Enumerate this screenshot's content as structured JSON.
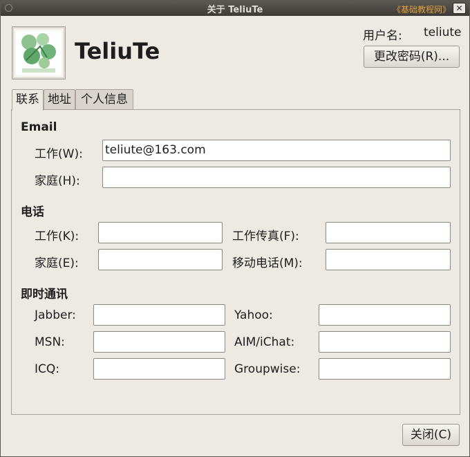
{
  "window": {
    "title": "关于 TeliuTe",
    "watermark": "《基础教程网》",
    "close_glyph": "✕"
  },
  "header": {
    "display_name": "TeliuTe",
    "username_label": "用户名:",
    "username_value": "teliute",
    "change_password_label": "更改密码(R)..."
  },
  "tabs": [
    {
      "label": "联系",
      "active": true
    },
    {
      "label": "地址",
      "active": false
    },
    {
      "label": "个人信息",
      "active": false
    }
  ],
  "email": {
    "heading": "Email",
    "work_label": "工作(W):",
    "work_value": "teliute@163.com",
    "home_label": "家庭(H):",
    "home_value": ""
  },
  "phone": {
    "heading": "电话",
    "work_label": "工作(K):",
    "work_value": "",
    "work_fax_label": "工作传真(F):",
    "work_fax_value": "",
    "home_label": "家庭(E):",
    "home_value": "",
    "mobile_label": "移动电话(M):",
    "mobile_value": ""
  },
  "im": {
    "heading": "即时通讯",
    "jabber_label": "Jabber:",
    "jabber_value": "",
    "yahoo_label": "Yahoo:",
    "yahoo_value": "",
    "msn_label": "MSN:",
    "msn_value": "",
    "aim_label": "AIM/iChat:",
    "aim_value": "",
    "icq_label": "ICQ:",
    "icq_value": "",
    "groupwise_label": "Groupwise:",
    "groupwise_value": ""
  },
  "footer": {
    "close_label": "关闭(C)"
  },
  "colors": {
    "titlebar": "#3d3b37",
    "dialog_bg": "#ede9e3",
    "watermark": "#e0a040",
    "photo_leaf": "#6fb47a"
  },
  "icons": {
    "photo": "user-photo-icon",
    "window_menu": "window-menu-icon",
    "close": "close-icon"
  }
}
